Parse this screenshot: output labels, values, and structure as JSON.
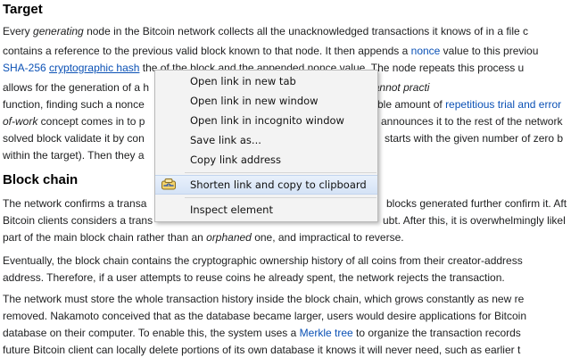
{
  "article": {
    "target_heading": "Target",
    "target_lines": [
      {
        "a": "Every ",
        "b": "generating",
        "c": " node in the Bitcoin network collects all the unacknowledged transactions it knows of in a file c"
      },
      {
        "a": "contains a reference to the previous valid block known to that node. It then appends a ",
        "link": "nonce",
        "c": " value to this previou"
      },
      {
        "link1": "SHA-256",
        "link2": "cryptographic hash",
        "a": "the",
        "c": " of the block and the appended nonce value. The node repeats this process u"
      },
      {
        "a": "allows for the generation of a h",
        "c": "get. Because computers cannot practi"
      },
      {
        "a": "function, finding such a nonce",
        "c": "ble amount of ",
        "link": "repetitious trial and error"
      },
      {
        "a": "of-work",
        "c": " concept comes in to p",
        "d": "announces it to the rest of the network"
      },
      {
        "a": "solved block validate it by con",
        "c": "starts with the given number of zero b"
      },
      {
        "a": "within the target). Then they a"
      }
    ],
    "blockchain_heading": "Block chain",
    "block_lines": [
      {
        "a": "The network confirms a transa",
        "c": "blocks generated further confirm it. Aft"
      },
      {
        "a": "Bitcoin clients considers a trans",
        "c": "ubt. After this, it is overwhelmingly likel"
      },
      {
        "a": "part of the main block chain rather than an ",
        "b": "orphaned",
        "c": " one, and impractical to reverse."
      }
    ],
    "para3": [
      "Eventually, the block chain contains the cryptographic ownership history of all coins from their creator-address",
      "address. Therefore, if a user attempts to reuse coins he already spent, the network rejects the transaction."
    ],
    "para4": [
      {
        "a": "The network must store the whole transaction history inside the block chain, which grows constantly as new re"
      },
      {
        "a": "removed. Nakamoto conceived that as the database became larger, users would desire applications for Bitcoin"
      },
      {
        "a": "database on their computer. To enable this, the system uses a ",
        "link": "Merkle tree",
        "c": " to organize the transaction records"
      },
      {
        "a": "future Bitcoin client can locally delete portions of its own database it knows it will never need, such as earlier t"
      }
    ]
  },
  "context_menu": {
    "items": [
      "Open link in new tab",
      "Open link in new window",
      "Open link in incognito window",
      "Save link as...",
      "Copy link address"
    ],
    "extension_item": "Shorten link and copy to clipboard",
    "inspect_item": "Inspect element",
    "extension_icon": "link-shortener-icon"
  },
  "colors": {
    "link": "#0b51b5",
    "menu_bg": "#f3f3f3",
    "highlight": "#d5e3f6"
  }
}
